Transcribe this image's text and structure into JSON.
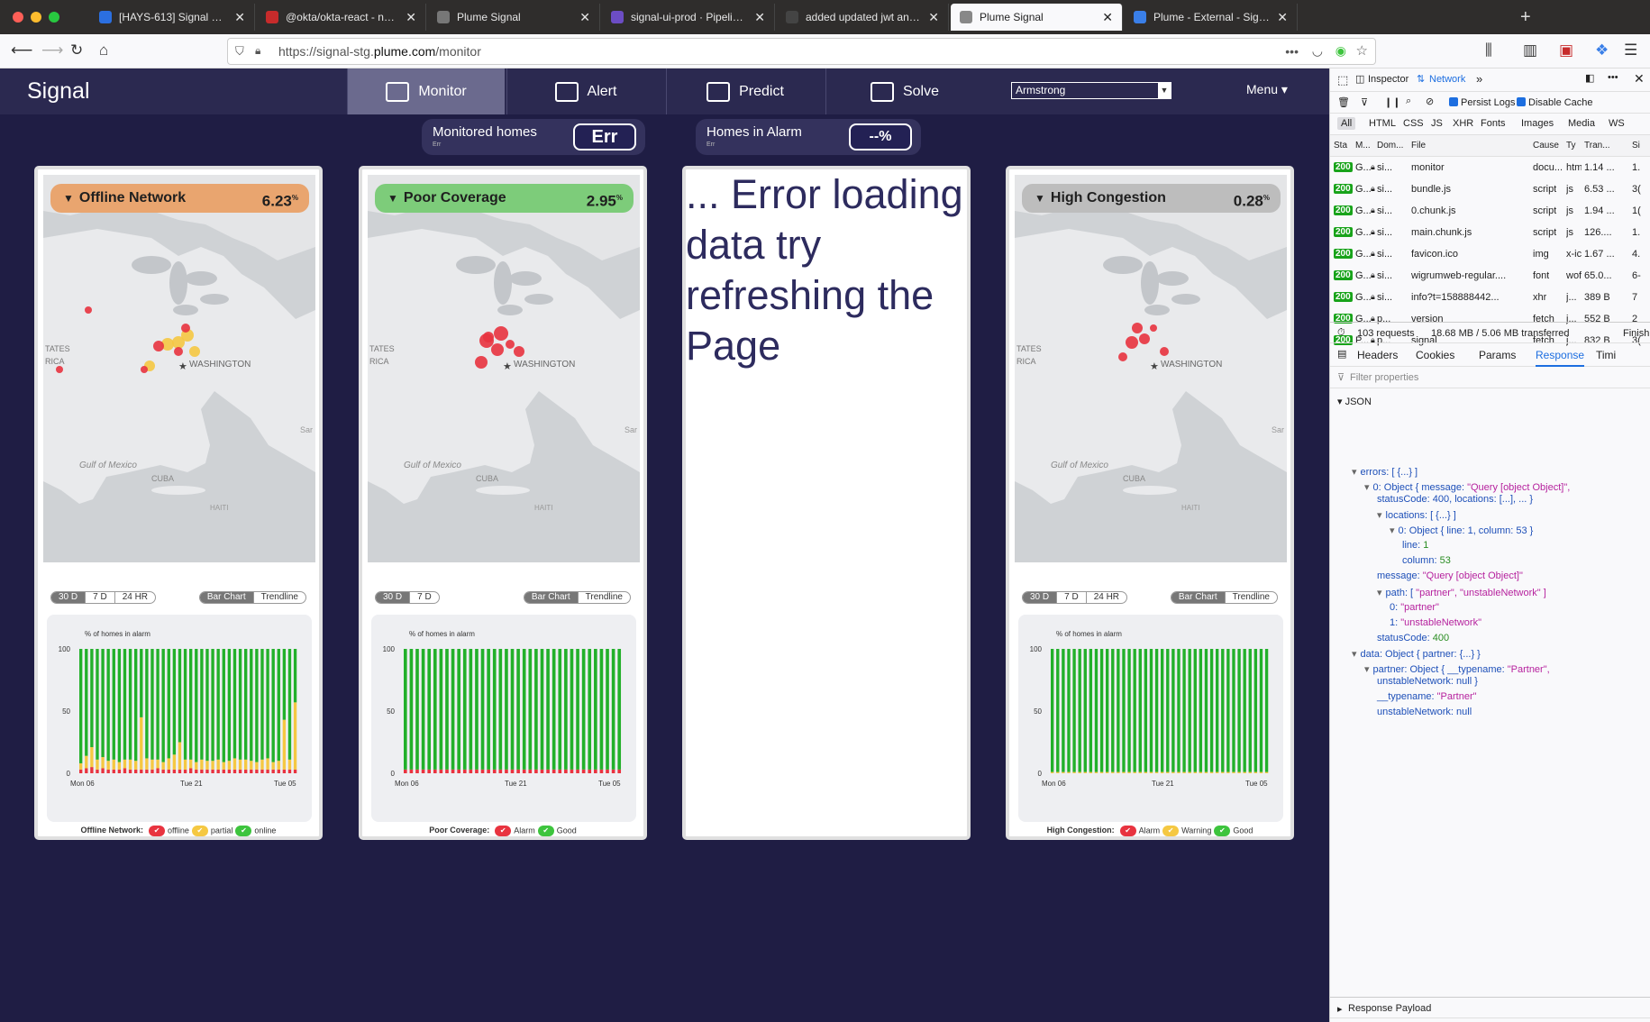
{
  "browser": {
    "tabs": [
      {
        "title": "[HAYS-613] Signal UI should re",
        "color": "#2b6fe0"
      },
      {
        "title": "@okta/okta-react - npm",
        "color": "#c72b2b"
      },
      {
        "title": "Plume Signal",
        "color": "#777"
      },
      {
        "title": "signal-ui-prod · Pipeline | Hero",
        "color": "#6c4dc4"
      },
      {
        "title": "added updated jwt and logout f",
        "color": "#444"
      },
      {
        "title": "Plume Signal",
        "color": "#888",
        "active": true
      },
      {
        "title": "Plume - External - Sign In",
        "color": "#3a7fe8"
      }
    ],
    "url_prefix": "https://signal-stg.",
    "url_domain": "plume.com",
    "url_path": "/monitor",
    "ellipsis": "•••"
  },
  "app": {
    "brand": "Signal",
    "nav": [
      {
        "label": "Monitor",
        "active": true
      },
      {
        "label": "Alert"
      },
      {
        "label": "Predict"
      },
      {
        "label": "Solve"
      }
    ],
    "partner": "Armstrong",
    "menu": "Menu ▾",
    "monitored": {
      "label": "Monitored homes",
      "sub": "Err",
      "value": "Err"
    },
    "alarm": {
      "label": "Homes in Alarm",
      "sub": "Err",
      "value": "--%"
    }
  },
  "cards": [
    {
      "title": "Offline Network",
      "value": "6.23",
      "unit": "%",
      "color": "#e9a56f",
      "chart_fill": "mixed",
      "ranges": [
        "30 D",
        "7 D",
        "24 HR"
      ],
      "views": [
        "Bar Chart",
        "Trendline"
      ],
      "legend_title": "Offline Network:",
      "legend": [
        {
          "label": "offline",
          "color": "#e8333f"
        },
        {
          "label": "partial",
          "color": "#f5c842"
        },
        {
          "label": "online",
          "color": "#3dc43d"
        }
      ]
    },
    {
      "title": "Poor Coverage",
      "value": "2.95",
      "unit": "%",
      "color": "#7dcc7a",
      "chart_fill": "green",
      "ranges": [
        "30 D",
        "7 D"
      ],
      "views": [
        "Bar Chart",
        "Trendline"
      ],
      "legend_title": "Poor Coverage:",
      "legend": [
        {
          "label": "Alarm",
          "color": "#e8333f"
        },
        {
          "label": "Good",
          "color": "#3dc43d"
        }
      ]
    },
    {
      "error": "... Error loading data try refreshing the Page"
    },
    {
      "title": "High Congestion",
      "value": "0.28",
      "unit": "%",
      "color": "#bdbdbd",
      "chart_fill": "green",
      "ranges": [
        "30 D",
        "7 D",
        "24 HR"
      ],
      "views": [
        "Bar Chart",
        "Trendline"
      ],
      "legend_title": "High Congestion:",
      "legend": [
        {
          "label": "Alarm",
          "color": "#e8333f"
        },
        {
          "label": "Warning",
          "color": "#f5c842"
        },
        {
          "label": "Good",
          "color": "#3dc43d"
        }
      ]
    }
  ],
  "map_labels": {
    "washington": "WASHINGTON",
    "states": "TATES",
    "rica": "RICA",
    "gulf": "Gulf of Mexico",
    "cuba": "CUBA",
    "haiti": "HAITI",
    "sarg": "Sar"
  },
  "chart": {
    "title": "% of homes in alarm",
    "yticks": [
      "100",
      "50",
      "0"
    ],
    "xticks": [
      "Mon 06",
      "Tue 21",
      "Tue 05"
    ]
  },
  "chart_data": [
    {
      "type": "bar",
      "title": "% of homes in alarm",
      "ylim": [
        0,
        100
      ],
      "yticks": [
        0,
        50,
        100
      ],
      "xticks": [
        "Mon 06",
        "Tue 21",
        "Tue 05"
      ],
      "series": [
        {
          "name": "offline",
          "values": [
            3,
            4,
            5,
            3,
            4,
            3,
            3,
            3,
            4,
            3,
            3,
            3,
            3,
            3,
            4,
            3,
            3,
            3,
            3,
            3,
            4,
            3,
            3,
            3,
            3,
            3,
            3,
            3,
            3,
            3,
            3,
            3,
            3,
            3,
            3,
            3,
            3,
            3,
            3,
            3
          ]
        },
        {
          "name": "partial",
          "values": [
            5,
            10,
            16,
            8,
            9,
            7,
            8,
            6,
            7,
            8,
            7,
            42,
            9,
            8,
            7,
            6,
            9,
            12,
            22,
            8,
            7,
            6,
            8,
            7,
            7,
            8,
            6,
            7,
            9,
            8,
            8,
            7,
            6,
            8,
            9,
            6,
            7,
            40,
            8,
            54
          ]
        },
        {
          "name": "online",
          "values": [
            92,
            86,
            79,
            89,
            87,
            90,
            89,
            91,
            89,
            89,
            90,
            55,
            88,
            89,
            89,
            91,
            88,
            85,
            75,
            89,
            89,
            91,
            89,
            90,
            90,
            89,
            91,
            90,
            88,
            89,
            89,
            90,
            91,
            89,
            88,
            91,
            90,
            57,
            89,
            43
          ]
        }
      ]
    },
    {
      "type": "bar",
      "title": "% of homes in alarm",
      "ylim": [
        0,
        100
      ],
      "yticks": [
        0,
        50,
        100
      ],
      "xticks": [
        "Mon 06",
        "Tue 21",
        "Tue 05"
      ],
      "series": [
        {
          "name": "Alarm",
          "values": [
            3,
            3,
            3,
            3,
            3,
            3,
            3,
            3,
            3,
            3,
            3,
            3,
            3,
            3,
            3,
            3,
            3,
            3,
            3,
            3,
            3,
            3,
            3,
            3,
            3,
            3,
            3,
            3,
            3,
            3,
            3,
            3,
            3,
            3,
            3,
            3,
            3
          ]
        },
        {
          "name": "Good",
          "values": [
            97,
            97,
            97,
            97,
            97,
            97,
            97,
            97,
            97,
            97,
            97,
            97,
            97,
            97,
            97,
            97,
            97,
            97,
            97,
            97,
            97,
            97,
            97,
            97,
            97,
            97,
            97,
            97,
            97,
            97,
            97,
            97,
            97,
            97,
            97,
            97,
            97
          ]
        }
      ]
    },
    {
      "type": "bar",
      "title": "% of homes in alarm",
      "ylim": [
        0,
        100
      ],
      "yticks": [
        0,
        50,
        100
      ],
      "xticks": [
        "Mon 06",
        "Tue 21",
        "Tue 05"
      ],
      "series": [
        {
          "name": "Warning",
          "values": [
            1,
            1,
            1,
            1,
            1,
            1,
            1,
            1,
            1,
            1,
            1,
            1,
            1,
            1,
            1,
            1,
            1,
            1,
            1,
            1,
            1,
            1,
            1,
            1,
            1,
            1,
            1,
            1,
            1,
            1,
            1,
            1,
            1,
            1,
            1,
            1,
            1,
            1,
            1,
            1
          ]
        },
        {
          "name": "Good",
          "values": [
            99,
            99,
            99,
            99,
            99,
            99,
            99,
            99,
            99,
            99,
            99,
            99,
            99,
            99,
            99,
            99,
            99,
            99,
            99,
            99,
            99,
            99,
            99,
            99,
            99,
            99,
            99,
            99,
            99,
            99,
            99,
            99,
            99,
            99,
            99,
            99,
            99,
            99,
            99,
            99
          ]
        }
      ]
    }
  ],
  "devtools": {
    "tabs": [
      "Inspector",
      "Network"
    ],
    "toolbar": {
      "persist": "Persist Logs",
      "disable": "Disable Cache"
    },
    "filters": [
      "All",
      "HTML",
      "CSS",
      "JS",
      "XHR",
      "Fonts",
      "Images",
      "Media",
      "WS"
    ],
    "columns": [
      "Sta",
      "M...",
      "Dom...",
      "File",
      "Cause",
      "Ty",
      "Tran...",
      "Si"
    ],
    "rows": [
      [
        "200",
        "G...",
        "si...",
        "monitor",
        "docu...",
        "htm",
        "1.14 ...",
        "1."
      ],
      [
        "200",
        "G...",
        "si...",
        "bundle.js",
        "script",
        "js",
        "6.53 ...",
        "3("
      ],
      [
        "200",
        "G...",
        "si...",
        "0.chunk.js",
        "script",
        "js",
        "1.94 ...",
        "1("
      ],
      [
        "200",
        "G...",
        "si...",
        "main.chunk.js",
        "script",
        "js",
        "126....",
        "1."
      ],
      [
        "200",
        "G...",
        "si...",
        "favicon.ico",
        "img",
        "x-ic",
        "1.67 ...",
        "4."
      ],
      [
        "200",
        "G...",
        "si...",
        "wigrumweb-regular....",
        "font",
        "wof",
        "65.0...",
        "6-"
      ],
      [
        "200",
        "G...",
        "si...",
        "info?t=158888442...",
        "xhr",
        "j...",
        "389 B",
        "7"
      ],
      [
        "200",
        "G...",
        "p...",
        "version",
        "fetch",
        "j...",
        "552 B",
        "2"
      ],
      [
        "200",
        "P...",
        "p...",
        "signal",
        "fetch",
        "j...",
        "832 B",
        "3("
      ]
    ],
    "summary": {
      "requests": "103 requests",
      "size": "18.68 MB / 5.06 MB transferred",
      "finish": "Finish"
    },
    "detail_tabs": [
      "Headers",
      "Cookies",
      "Params",
      "Response",
      "Timi"
    ],
    "filter_placeholder": "Filter properties",
    "json_label": "JSON",
    "payload": "Response Payload",
    "json_lines": [
      {
        "i": 1,
        "a": "▾",
        "k": "errors: ",
        "v": "[ {...} ]",
        "c": "k"
      },
      {
        "i": 2,
        "a": "▾",
        "k": "0: Object { message: ",
        "v": "\"Query [object Object]\",",
        "c": "s"
      },
      {
        "i": 3,
        "a": "",
        "k": "statusCode: 400, locations: [...], ... }",
        "v": "",
        "c": "k"
      },
      {
        "i": 3,
        "a": "▾",
        "k": "locations: ",
        "v": "[ {...} ]",
        "c": "k"
      },
      {
        "i": 4,
        "a": "▾",
        "k": "0: Object { line: 1, column: 53 }",
        "v": "",
        "c": "k"
      },
      {
        "i": 5,
        "a": "",
        "k": "line: ",
        "v": "1",
        "c": "n"
      },
      {
        "i": 5,
        "a": "",
        "k": "column: ",
        "v": "53",
        "c": "n"
      },
      {
        "i": 3,
        "a": "",
        "k": "message: ",
        "v": "\"Query [object Object]\"",
        "c": "s"
      },
      {
        "i": 3,
        "a": "▾",
        "k": "path: [ ",
        "v": "\"partner\", \"unstableNetwork\" ]",
        "c": "s"
      },
      {
        "i": 4,
        "a": "",
        "k": "0: ",
        "v": "\"partner\"",
        "c": "s"
      },
      {
        "i": 4,
        "a": "",
        "k": "1: ",
        "v": "\"unstableNetwork\"",
        "c": "s"
      },
      {
        "i": 3,
        "a": "",
        "k": "statusCode: ",
        "v": "400",
        "c": "n"
      },
      {
        "i": 1,
        "a": "▾",
        "k": "data: Object { partner: {...} }",
        "v": "",
        "c": "k"
      },
      {
        "i": 2,
        "a": "▾",
        "k": "partner: Object { __typename: ",
        "v": "\"Partner\",",
        "c": "s"
      },
      {
        "i": 3,
        "a": "",
        "k": "unstableNetwork: null }",
        "v": "",
        "c": "k"
      },
      {
        "i": 3,
        "a": "",
        "k": "__typename: ",
        "v": "\"Partner\"",
        "c": "s"
      },
      {
        "i": 3,
        "a": "",
        "k": "unstableNetwork: ",
        "v": "null",
        "c": "k"
      }
    ]
  }
}
